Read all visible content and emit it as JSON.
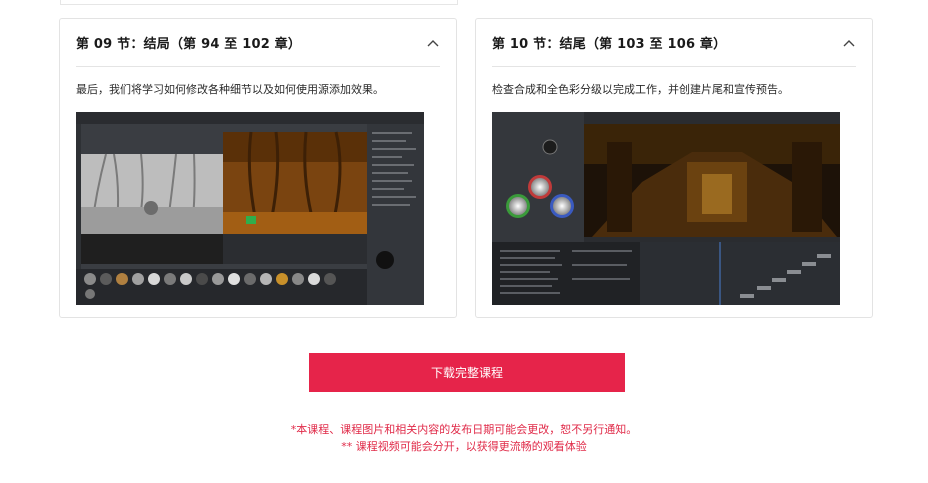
{
  "chapters": [
    {
      "title": "第 09 节：结局（第 94 至 102 章）",
      "description": "最后，我们将学习如何修改各种细节以及如何使用源添加效果。",
      "toggle_icon": "chevron-up-icon"
    },
    {
      "title": "第 10 节：结尾（第 103 至 106 章）",
      "description": "检查合成和全色彩分级以完成工作，并创建片尾和宣传预告。",
      "toggle_icon": "chevron-up-icon"
    }
  ],
  "download": {
    "label": "下载完整课程"
  },
  "notes": {
    "line1": "*本课程、课程图片和相关内容的发布日期可能会更改，恕不另行通知。",
    "line2": "** 课程视频可能会分开，以获得更流畅的观看体验"
  },
  "colors": {
    "accent": "#e6244a",
    "note_text": "#e02a48",
    "border": "#e3e3e3"
  }
}
